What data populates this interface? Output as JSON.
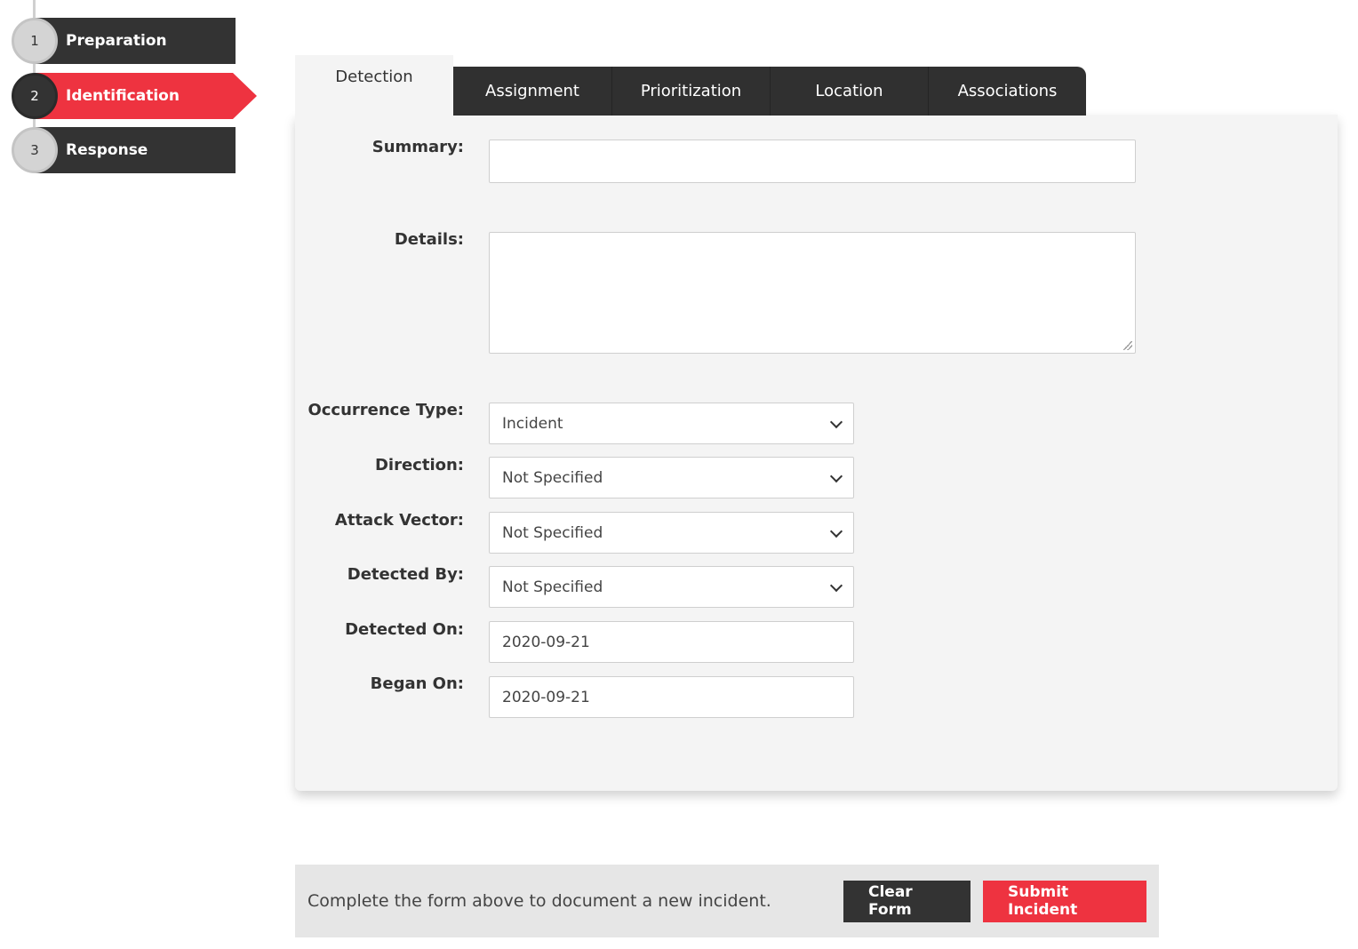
{
  "stepper": {
    "steps": [
      {
        "number": "1",
        "label": "Preparation"
      },
      {
        "number": "2",
        "label": "Identification"
      },
      {
        "number": "3",
        "label": "Response"
      }
    ],
    "active_color": "#ee3340",
    "inactive_color": "#333333"
  },
  "tabs": {
    "items": [
      {
        "label": "Detection"
      },
      {
        "label": "Assignment"
      },
      {
        "label": "Prioritization"
      },
      {
        "label": "Location"
      },
      {
        "label": "Associations"
      }
    ],
    "active": "Detection"
  },
  "form": {
    "summary": {
      "label": "Summary:",
      "value": ""
    },
    "details": {
      "label": "Details:",
      "value": ""
    },
    "occurrence_type": {
      "label": "Occurrence Type:",
      "value": "Incident"
    },
    "direction": {
      "label": "Direction:",
      "value": "Not Specified"
    },
    "attack_vector": {
      "label": "Attack Vector:",
      "value": "Not Specified"
    },
    "detected_by": {
      "label": "Detected By:",
      "value": "Not Specified"
    },
    "detected_on": {
      "label": "Detected On:",
      "value": "2020-09-21"
    },
    "began_on": {
      "label": "Began On:",
      "value": "2020-09-21"
    }
  },
  "footer": {
    "message": "Complete the form above to document a new incident.",
    "clear_label": "Clear Form",
    "submit_label": "Submit Incident"
  }
}
